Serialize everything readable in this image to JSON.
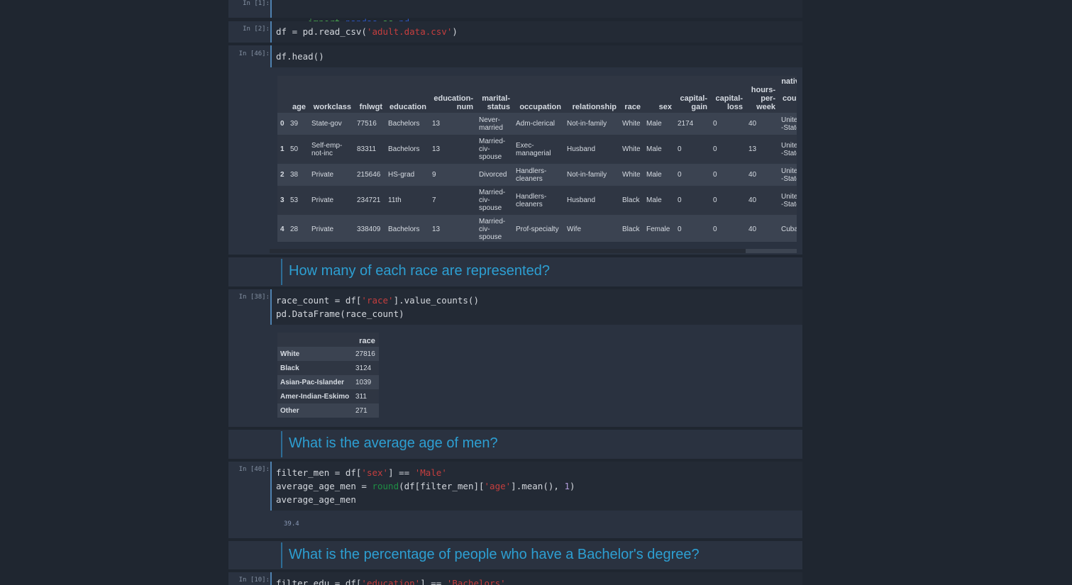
{
  "cells": {
    "c1": {
      "prompt": "In [1]:"
    },
    "c2": {
      "prompt": "In [2]:"
    },
    "c3": {
      "prompt": "In [46]:",
      "code": "df.head()"
    },
    "c4": {
      "prompt": "In [38]:"
    },
    "c5": {
      "prompt": "In [40]:"
    },
    "c6": {
      "prompt": "In [10]:"
    }
  },
  "code_tokens": {
    "import_kw": "import",
    "pandas": "pandas",
    "as_kw": "as",
    "pd": "pd",
    "df_read_prefix": "df = pd.read_csv(",
    "csv_file": "'adult.data.csv'",
    "close_paren": ")",
    "race_count_prefix": "race_count = df[",
    "race_str": "'race'",
    "race_count_suffix": "].value_counts()",
    "dataframe_line": "pd.DataFrame(race_count)",
    "filter_men_prefix": "filter_men = df[",
    "sex_str": "'sex'",
    "eq": "] == ",
    "male_str": "'Male'",
    "avg_prefix": "average_age_men = ",
    "round_fn": "round",
    "avg_mid": "(df[filter_men][",
    "age_str": "'age'",
    "avg_suffix": "].mean(), ",
    "one": "1",
    "avg_end": ")",
    "avg_line": "average_age_men",
    "filter_edu_prefix": "filter_edu = df[",
    "education_str": "'education'",
    "eq2": "] == ",
    "bachelors_str": "'Bachelors'"
  },
  "head_table": {
    "columns": [
      "",
      "age",
      "workclass",
      "fnlwgt",
      "education",
      "education-num",
      "marital-status",
      "occupation",
      "relationship",
      "race",
      "sex",
      "capital-gain",
      "capital-loss",
      "hours-per-week",
      "native-country"
    ],
    "rows": [
      [
        "0",
        "39",
        "State-gov",
        "77516",
        "Bachelors",
        "13",
        "Never-married",
        "Adm-clerical",
        "Not-in-family",
        "White",
        "Male",
        "2174",
        "0",
        "40",
        "United-States"
      ],
      [
        "1",
        "50",
        "Self-emp-not-inc",
        "83311",
        "Bachelors",
        "13",
        "Married-civ-spouse",
        "Exec-managerial",
        "Husband",
        "White",
        "Male",
        "0",
        "0",
        "13",
        "United-States"
      ],
      [
        "2",
        "38",
        "Private",
        "215646",
        "HS-grad",
        "9",
        "Divorced",
        "Handlers-cleaners",
        "Not-in-family",
        "White",
        "Male",
        "0",
        "0",
        "40",
        "United-States"
      ],
      [
        "3",
        "53",
        "Private",
        "234721",
        "11th",
        "7",
        "Married-civ-spouse",
        "Handlers-cleaners",
        "Husband",
        "Black",
        "Male",
        "0",
        "0",
        "40",
        "United-States"
      ],
      [
        "4",
        "28",
        "Private",
        "338409",
        "Bachelors",
        "13",
        "Married-civ-spouse",
        "Prof-specialty",
        "Wife",
        "Black",
        "Female",
        "0",
        "0",
        "40",
        "Cuba"
      ]
    ]
  },
  "race_table": {
    "header": "race",
    "rows": [
      [
        "White",
        "27816"
      ],
      [
        "Black",
        "3124"
      ],
      [
        "Asian-Pac-Islander",
        "1039"
      ],
      [
        "Amer-Indian-Eskimo",
        "311"
      ],
      [
        "Other",
        "271"
      ]
    ]
  },
  "markdown": {
    "q1": "How many of each race are represented?",
    "q2": "What is the average age of men?",
    "q3": "What is the percentage of people who have a Bachelor's degree?"
  },
  "outputs": {
    "avg_age": "39.4"
  }
}
